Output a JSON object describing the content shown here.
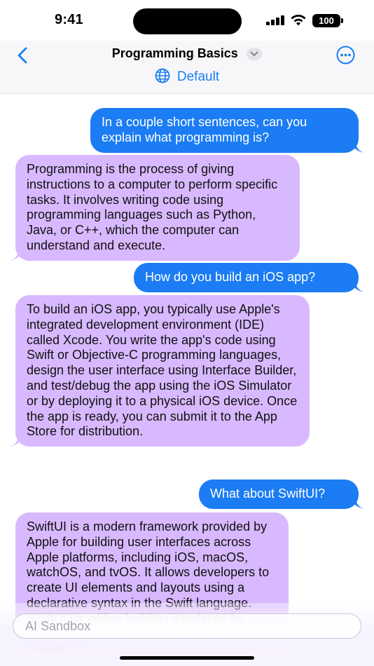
{
  "status_bar": {
    "time": "9:41",
    "battery": "100"
  },
  "nav": {
    "title": "Programming Basics",
    "model": "Default",
    "icons": [
      "back-chevron-icon",
      "chevron-down-icon",
      "more-ellipsis-icon",
      "globe-icon"
    ]
  },
  "messages": [
    {
      "role": "user",
      "text": "In a couple short sentences, can you explain what programming is?"
    },
    {
      "role": "assistant",
      "text": "Programming is the process of giving instructions to a computer to perform specific tasks. It involves writing code using programming languages such as Python, Java, or C++, which the computer can understand and execute."
    },
    {
      "role": "user",
      "text": "How do you build an iOS app?"
    },
    {
      "role": "assistant",
      "text": "To build an iOS app, you typically use Apple's integrated development environment (IDE) called Xcode. You write the app's code using Swift or Objective-C programming languages, design the user interface using Interface Builder, and test/debug the app using the iOS Simulator or by deploying it to a physical iOS device. Once the app is ready, you can submit it to the App Store for distribution."
    },
    {
      "role": "user",
      "text": "What about SwiftUI?"
    },
    {
      "role": "assistant",
      "text": "SwiftUI is a modern framework provided by Apple for building user interfaces across Apple platforms, including iOS, macOS, watchOS, and tvOS. It allows developers to create UI elements and layouts using a declarative syntax in the Swift language. SwiftUI simplifies building interfaces by providing powerful tools and features for creating..."
    }
  ],
  "composer": {
    "placeholder": "AI Sandbox"
  },
  "colors": {
    "accent": "#1b7cf3",
    "assistant_bubble": "#d8b9ff"
  }
}
